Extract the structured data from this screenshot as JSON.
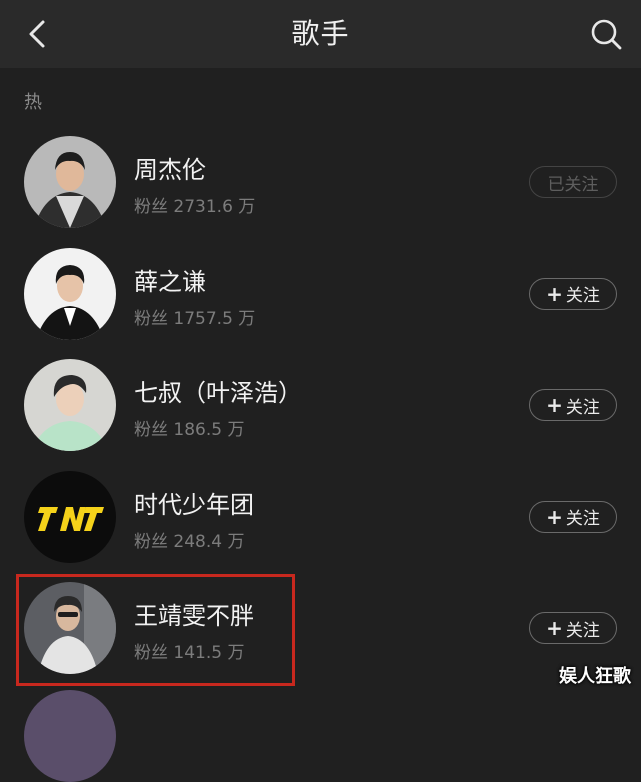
{
  "header": {
    "title": "歌手",
    "back_icon": "chevron-left-icon",
    "search_icon": "search-icon"
  },
  "section": {
    "label": "热"
  },
  "artists": [
    {
      "name": "周杰伦",
      "fans": "粉丝 2731.6 万",
      "follow_label": "已关注",
      "followed": true
    },
    {
      "name": "薛之谦",
      "fans": "粉丝 1757.5 万",
      "follow_label": "关注",
      "followed": false
    },
    {
      "name": "七叔（叶泽浩）",
      "fans": "粉丝 186.5 万",
      "follow_label": "关注",
      "followed": false
    },
    {
      "name": "时代少年团",
      "fans": "粉丝 248.4 万",
      "follow_label": "关注",
      "followed": false
    },
    {
      "name": "王靖雯不胖",
      "fans": "粉丝 141.5 万",
      "follow_label": "关注",
      "followed": false
    }
  ],
  "watermark": "娱人狂歌",
  "colors": {
    "background": "#202020",
    "header_bg": "#2a2a2a",
    "highlight": "#c8281e",
    "logo_yellow": "#f5d21a"
  }
}
